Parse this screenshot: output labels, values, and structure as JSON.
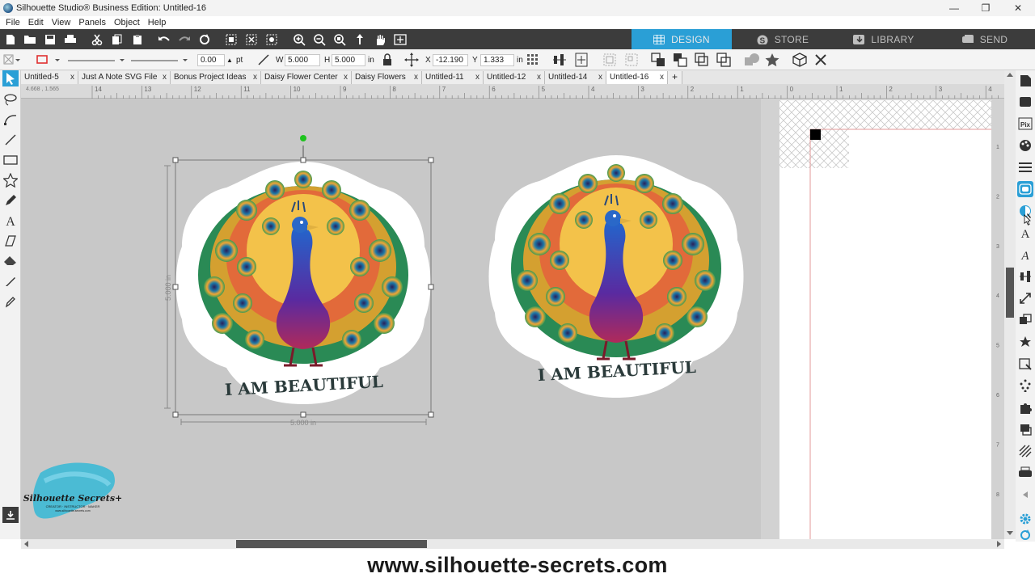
{
  "window": {
    "title": "Silhouette Studio® Business Edition: Untitled-16",
    "minimize": "—",
    "maximize": "❐",
    "close": "✕"
  },
  "menu": [
    "File",
    "Edit",
    "View",
    "Panels",
    "Object",
    "Help"
  ],
  "modes": {
    "design": "DESIGN",
    "store": "STORE",
    "library": "LIBRARY",
    "send": "SEND",
    "active_color": "#2a9fd6"
  },
  "properties": {
    "line_width": "0.00",
    "line_unit": "pt",
    "w_label": "W",
    "w_value": "5.000",
    "h_label": "H",
    "h_value": "5.000",
    "size_unit": "in",
    "x_label": "X",
    "x_value": "-12.190",
    "y_label": "Y",
    "y_value": "1.333",
    "pos_unit": "in"
  },
  "tabs": [
    {
      "label": "Untitled-5",
      "active": false
    },
    {
      "label": "Just A Note SVG File",
      "active": false
    },
    {
      "label": "Bonus Project Ideas",
      "active": false
    },
    {
      "label": "Daisy Flower Center",
      "active": false
    },
    {
      "label": "Daisy Flowers",
      "active": false
    },
    {
      "label": "Untitled-11",
      "active": false
    },
    {
      "label": "Untitled-12",
      "active": false
    },
    {
      "label": "Untitled-14",
      "active": false
    },
    {
      "label": "Untitled-16",
      "active": true
    }
  ],
  "tab_close": "x",
  "tab_add": "+",
  "ruler_ticks": [
    "14",
    "13",
    "12",
    "11",
    "10",
    "9",
    "8",
    "7",
    "6",
    "5",
    "4",
    "3",
    "2",
    "1",
    "0",
    "1",
    "2",
    "3",
    "4"
  ],
  "ruler_readout": "4.668 , 1.565",
  "vruler_ticks": [
    "1",
    "2",
    "3",
    "4",
    "5",
    "6",
    "7",
    "8"
  ],
  "selection": {
    "height_label": "5.000 in",
    "width_label": "5.000 in"
  },
  "stickers": [
    {
      "caption": "I AM BEAUTIFUL"
    },
    {
      "caption": "I AM BEAUTIFUL"
    }
  ],
  "watermark": {
    "brand": "Silhouette Secrets+",
    "tagline": "CREATOR · INSTRUCTOR · MAKER",
    "url": "www.silhouette-secrets.com"
  },
  "footer_url": "www.silhouette-secrets.com"
}
